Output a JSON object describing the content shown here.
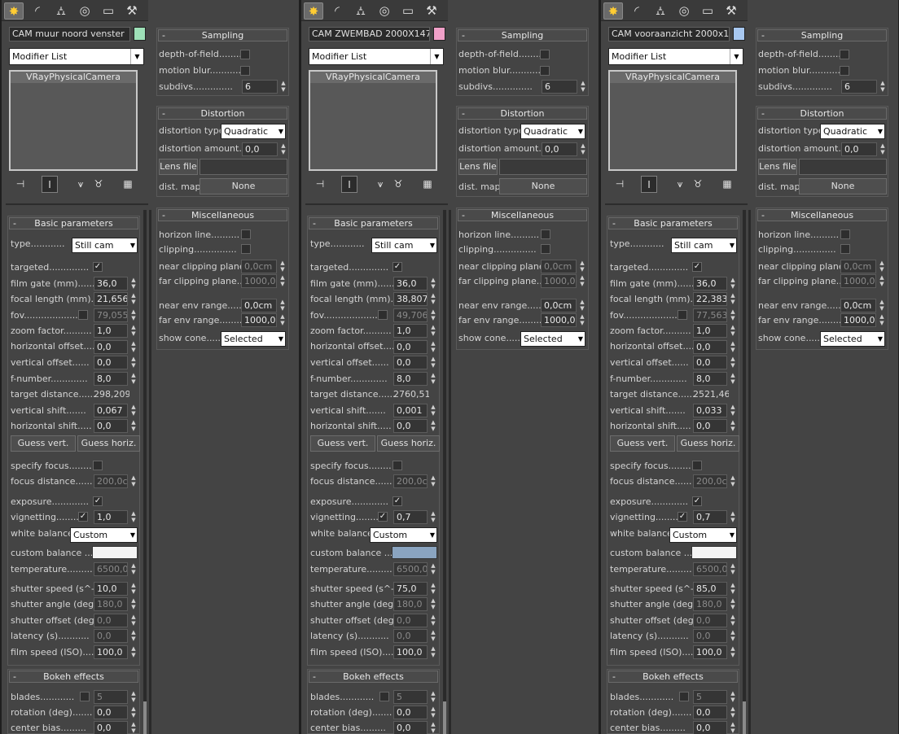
{
  "tabs": [
    "create-icon",
    "modify-icon",
    "hierarchy-icon",
    "motion-icon",
    "display-icon",
    "utilities-icon"
  ],
  "panels": [
    {
      "camera_name": "CAM muur noord venster",
      "swatch_color": "#9ee0b8",
      "modifier_list": "Modifier List",
      "stack_item": "VRayPhysicalCamera",
      "sampling": {
        "title": "Sampling",
        "dof": "depth-of-field........",
        "motion_blur": "motion blur...........",
        "subdivs": "subdivs..............",
        "subdivs_val": "6"
      },
      "distortion": {
        "title": "Distortion",
        "type_lbl": "distortion type.",
        "type_val": "Quadratic",
        "amount_lbl": "distortion amount...",
        "amount_val": "0,0",
        "lens_btn": "Lens file",
        "dist_map_lbl": "dist. map",
        "dist_map_val": "None"
      },
      "misc": {
        "title": "Miscellaneous",
        "horizon": "horizon line..........",
        "clipping": "clipping...............",
        "near_clip": "near clipping plane..",
        "near_clip_val": "0,0cm",
        "far_clip": "far clipping plane...",
        "far_clip_val": "1000,0c",
        "near_env": "near env range.......",
        "near_env_val": "0,0cm",
        "far_env": "far env range........",
        "far_env_val": "1000,0c",
        "show_cone": "show cone......",
        "show_cone_val": "Selected"
      },
      "basic": {
        "title": "Basic parameters",
        "type_lbl": "type............",
        "type_val": "Still cam",
        "targeted": "targeted..............",
        "film_gate": "film gate (mm).........",
        "film_gate_val": "36,0",
        "focal_length": "focal length (mm)....",
        "focal_length_val": "21,656",
        "fov": "fov...................",
        "fov_val": "79,055",
        "zoom": "zoom factor..........",
        "zoom_val": "1,0",
        "h_offset": "horizontal offset....",
        "h_offset_val": "0,0",
        "v_offset": "vertical offset......",
        "v_offset_val": "0,0",
        "fnumber": "f-number.............",
        "fnumber_val": "8,0",
        "target_dist": "target distance......",
        "target_dist_val": "298,209c",
        "v_shift": "vertical shift.......",
        "v_shift_val": "0,067",
        "h_shift": "horizontal shift.....",
        "h_shift_val": "0,0",
        "guess_v": "Guess vert.",
        "guess_h": "Guess horiz.",
        "specify_focus": "specify focus........",
        "focus_dist": "focus distance......",
        "focus_dist_val": "200,0cm",
        "exposure": "exposure.............",
        "vignetting": "vignetting........",
        "vignetting_val": "1,0",
        "wb": "white balance",
        "wb_val": "Custom",
        "custom_balance": "custom balance .....",
        "custom_balance_color": "#f4f4f4",
        "temperature": "temperature.........",
        "temperature_val": "6500,0",
        "shutter_speed": "shutter speed (s^-1",
        "shutter_speed_val": "10,0",
        "shutter_angle": "shutter angle (deg).",
        "shutter_angle_val": "180,0",
        "shutter_offset": "shutter offset (deg)",
        "shutter_offset_val": "0,0",
        "latency": "latency (s)...........",
        "latency_val": "0,0",
        "film_speed": "film speed (ISO).....",
        "film_speed_val": "100,0"
      },
      "bokeh": {
        "title": "Bokeh effects",
        "blades": "blades............",
        "blades_val": "5",
        "rotation": "rotation (deg).......",
        "rotation_val": "0,0",
        "center_bias": "center bias.........",
        "center_bias_val": "0,0"
      }
    },
    {
      "camera_name": "CAM ZWEMBAD 2000X1470",
      "swatch_color": "#f0a0c8",
      "modifier_list": "Modifier List",
      "stack_item": "VRayPhysicalCamera",
      "sampling": {
        "title": "Sampling",
        "dof": "depth-of-field........",
        "motion_blur": "motion blur...........",
        "subdivs": "subdivs..............",
        "subdivs_val": "6"
      },
      "distortion": {
        "title": "Distortion",
        "type_lbl": "distortion type.",
        "type_val": "Quadratic",
        "amount_lbl": "distortion amount...",
        "amount_val": "0,0",
        "lens_btn": "Lens file",
        "dist_map_lbl": "dist. map",
        "dist_map_val": "None"
      },
      "misc": {
        "title": "Miscellaneous",
        "horizon": "horizon line..........",
        "clipping": "clipping...............",
        "near_clip": "near clipping plane..",
        "near_clip_val": "0,0cm",
        "far_clip": "far clipping plane...",
        "far_clip_val": "1000,0c",
        "near_env": "near env range.......",
        "near_env_val": "0,0cm",
        "far_env": "far env range........",
        "far_env_val": "1000,0c",
        "show_cone": "show cone......",
        "show_cone_val": "Selected"
      },
      "basic": {
        "title": "Basic parameters",
        "type_lbl": "type............",
        "type_val": "Still cam",
        "targeted": "targeted..............",
        "film_gate": "film gate (mm).........",
        "film_gate_val": "36,0",
        "focal_length": "focal length (mm)....",
        "focal_length_val": "38,807",
        "fov": "fov...................",
        "fov_val": "49,706",
        "zoom": "zoom factor..........",
        "zoom_val": "1,0",
        "h_offset": "horizontal offset....",
        "h_offset_val": "0,0",
        "v_offset": "vertical offset......",
        "v_offset_val": "0,0",
        "fnumber": "f-number.............",
        "fnumber_val": "8,0",
        "target_dist": "target distance......",
        "target_dist_val": "2760,51",
        "v_shift": "vertical shift.......",
        "v_shift_val": "0,001",
        "h_shift": "horizontal shift.....",
        "h_shift_val": "0,0",
        "guess_v": "Guess vert.",
        "guess_h": "Guess horiz.",
        "specify_focus": "specify focus........",
        "focus_dist": "focus distance......",
        "focus_dist_val": "200,0cm",
        "exposure": "exposure.............",
        "vignetting": "vignetting........",
        "vignetting_val": "0,7",
        "wb": "white balance",
        "wb_val": "Custom",
        "custom_balance": "custom balance .....",
        "custom_balance_color": "#8aa4c0",
        "temperature": "temperature.........",
        "temperature_val": "6500,0",
        "shutter_speed": "shutter speed (s^-1",
        "shutter_speed_val": "75,0",
        "shutter_angle": "shutter angle (deg).",
        "shutter_angle_val": "180,0",
        "shutter_offset": "shutter offset (deg)",
        "shutter_offset_val": "0,0",
        "latency": "latency (s)...........",
        "latency_val": "0,0",
        "film_speed": "film speed (ISO).....",
        "film_speed_val": "100,0"
      },
      "bokeh": {
        "title": "Bokeh effects",
        "blades": "blades............",
        "blades_val": "5",
        "rotation": "rotation (deg).......",
        "rotation_val": "0,0",
        "center_bias": "center bias.........",
        "center_bias_val": "0,0"
      }
    },
    {
      "camera_name": "CAM vooraanzicht 2000x1300",
      "swatch_color": "#a8c8f0",
      "modifier_list": "Modifier List",
      "stack_item": "VRayPhysicalCamera",
      "sampling": {
        "title": "Sampling",
        "dof": "depth-of-field........",
        "motion_blur": "motion blur...........",
        "subdivs": "subdivs..............",
        "subdivs_val": "6"
      },
      "distortion": {
        "title": "Distortion",
        "type_lbl": "distortion type.",
        "type_val": "Quadratic",
        "amount_lbl": "distortion amount...",
        "amount_val": "0,0",
        "lens_btn": "Lens file",
        "dist_map_lbl": "dist. map",
        "dist_map_val": "None"
      },
      "misc": {
        "title": "Miscellaneous",
        "horizon": "horizon line..........",
        "clipping": "clipping...............",
        "near_clip": "near clipping plane..",
        "near_clip_val": "0,0cm",
        "far_clip": "far clipping plane...",
        "far_clip_val": "1000,0c",
        "near_env": "near env range.......",
        "near_env_val": "0,0cm",
        "far_env": "far env range........",
        "far_env_val": "1000,0c",
        "show_cone": "show cone......",
        "show_cone_val": "Selected"
      },
      "basic": {
        "title": "Basic parameters",
        "type_lbl": "type............",
        "type_val": "Still cam",
        "targeted": "targeted..............",
        "film_gate": "film gate (mm).........",
        "film_gate_val": "36,0",
        "focal_length": "focal length (mm)....",
        "focal_length_val": "22,383",
        "fov": "fov...................",
        "fov_val": "77,563",
        "zoom": "zoom factor..........",
        "zoom_val": "1,0",
        "h_offset": "horizontal offset....",
        "h_offset_val": "0,0",
        "v_offset": "vertical offset......",
        "v_offset_val": "0,0",
        "fnumber": "f-number.............",
        "fnumber_val": "8,0",
        "target_dist": "target distance......",
        "target_dist_val": "2521,469",
        "v_shift": "vertical shift.......",
        "v_shift_val": "0,033",
        "h_shift": "horizontal shift.....",
        "h_shift_val": "0,0",
        "guess_v": "Guess vert.",
        "guess_h": "Guess horiz.",
        "specify_focus": "specify focus........",
        "focus_dist": "focus distance......",
        "focus_dist_val": "200,0cm",
        "exposure": "exposure.............",
        "vignetting": "vignetting........",
        "vignetting_val": "0,7",
        "wb": "white balance",
        "wb_val": "Custom",
        "custom_balance": "custom balance .....",
        "custom_balance_color": "#f4f4f4",
        "temperature": "temperature.........",
        "temperature_val": "6500,0",
        "shutter_speed": "shutter speed (s^-1",
        "shutter_speed_val": "85,0",
        "shutter_angle": "shutter angle (deg).",
        "shutter_angle_val": "180,0",
        "shutter_offset": "shutter offset (deg)",
        "shutter_offset_val": "0,0",
        "latency": "latency (s)...........",
        "latency_val": "0,0",
        "film_speed": "film speed (ISO).....",
        "film_speed_val": "100,0"
      },
      "bokeh": {
        "title": "Bokeh effects",
        "blades": "blades............",
        "blades_val": "5",
        "rotation": "rotation (deg).......",
        "rotation_val": "0,0",
        "center_bias": "center bias.........",
        "center_bias_val": "0,0"
      }
    }
  ]
}
